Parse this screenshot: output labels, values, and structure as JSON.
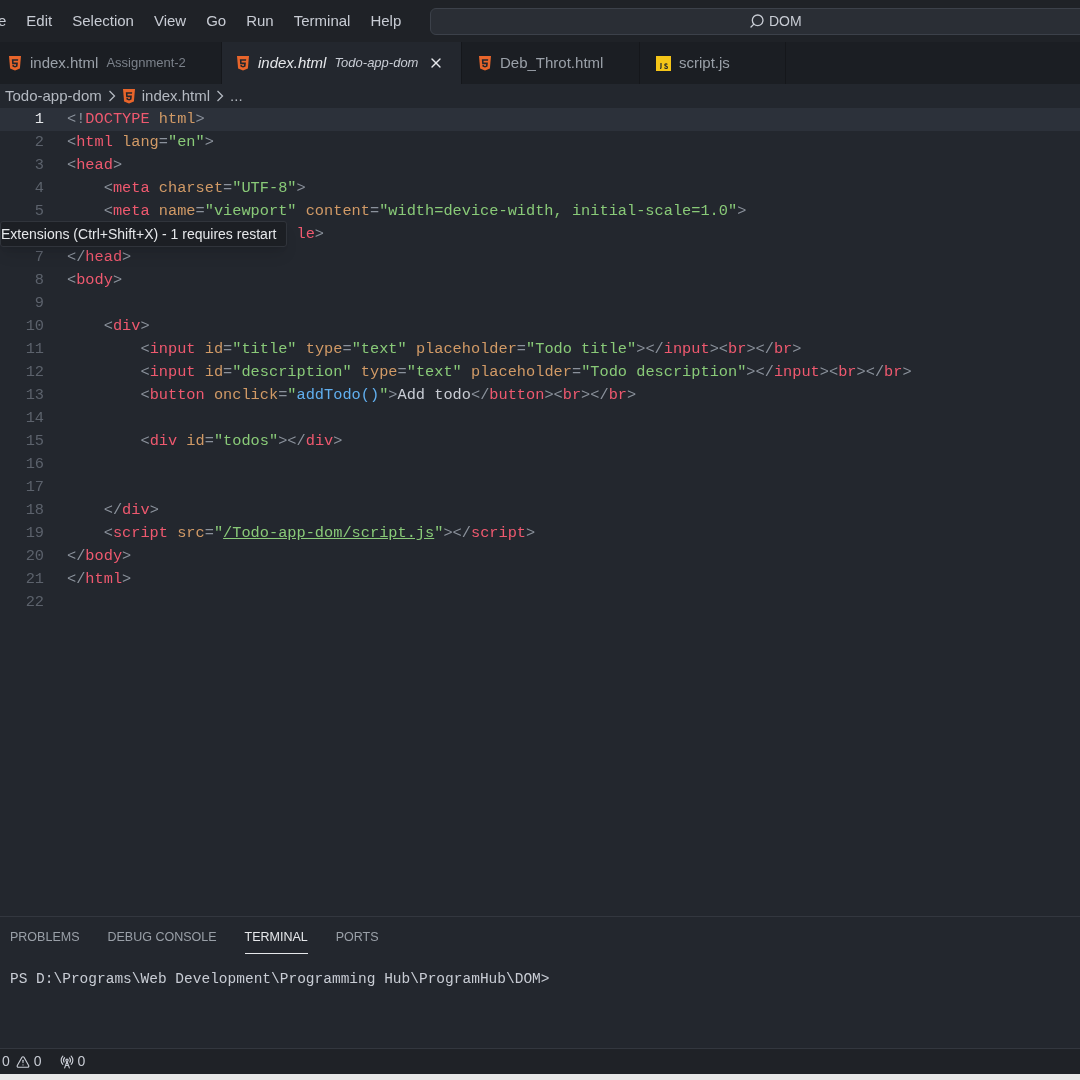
{
  "menu": [
    "e",
    "Edit",
    "Selection",
    "View",
    "Go",
    "Run",
    "Terminal",
    "Help"
  ],
  "search": {
    "value": "DOM"
  },
  "tabs": [
    {
      "label": "index.html",
      "description": "Assignment-2",
      "kind": "html",
      "selected": false,
      "preview": false
    },
    {
      "label": "index.html",
      "description": "Todo-app-dom",
      "kind": "html",
      "selected": true,
      "preview": true
    },
    {
      "label": "Deb_Throt.html",
      "kind": "html",
      "selected": false,
      "preview": false
    },
    {
      "label": "script.js",
      "kind": "js",
      "selected": false,
      "preview": false
    }
  ],
  "breadcrumb": [
    {
      "label": "Todo-app-dom",
      "kind": "folder"
    },
    {
      "label": "index.html",
      "kind": "html"
    },
    {
      "label": "...",
      "kind": "more"
    }
  ],
  "code_lines": [
    {
      "number": "1",
      "current": true,
      "tokens": [
        {
          "kind": "punct",
          "text": "<!"
        },
        {
          "kind": "tag",
          "text": "DOCTYPE"
        },
        {
          "kind": "attr",
          "text": " html"
        },
        {
          "kind": "punct",
          "text": ">"
        }
      ]
    },
    {
      "number": "2",
      "current": false,
      "tokens": [
        {
          "kind": "punct",
          "text": "<"
        },
        {
          "kind": "tag",
          "text": "html"
        },
        {
          "kind": "attr",
          "text": " lang"
        },
        {
          "kind": "punct",
          "text": "="
        },
        {
          "kind": "string",
          "text": "\"en\""
        },
        {
          "kind": "punct",
          "text": ">"
        }
      ]
    },
    {
      "number": "3",
      "current": false,
      "tokens": [
        {
          "kind": "punct",
          "text": "<"
        },
        {
          "kind": "tag",
          "text": "head"
        },
        {
          "kind": "punct",
          "text": ">"
        }
      ]
    },
    {
      "number": "4",
      "current": false,
      "tokens": [
        {
          "kind": "punct",
          "text": "    <"
        },
        {
          "kind": "tag",
          "text": "meta"
        },
        {
          "kind": "attr",
          "text": " charset"
        },
        {
          "kind": "punct",
          "text": "="
        },
        {
          "kind": "string",
          "text": "\"UTF-8\""
        },
        {
          "kind": "punct",
          "text": ">"
        }
      ]
    },
    {
      "number": "5",
      "current": false,
      "tokens": [
        {
          "kind": "punct",
          "text": "    <"
        },
        {
          "kind": "tag",
          "text": "meta"
        },
        {
          "kind": "attr",
          "text": " name"
        },
        {
          "kind": "punct",
          "text": "="
        },
        {
          "kind": "string",
          "text": "\"viewport\""
        },
        {
          "kind": "attr",
          "text": " content"
        },
        {
          "kind": "punct",
          "text": "="
        },
        {
          "kind": "string",
          "text": "\"width=device-width, initial-scale=1.0\""
        },
        {
          "kind": "punct",
          "text": ">"
        }
      ]
    },
    {
      "current": false,
      "tokens": [
        {
          "kind": "tag",
          "text": "                         le"
        },
        {
          "kind": "punct",
          "text": ">"
        }
      ]
    },
    {
      "number": "7",
      "current": false,
      "tokens": [
        {
          "kind": "punct",
          "text": "</"
        },
        {
          "kind": "tag",
          "text": "head"
        },
        {
          "kind": "punct",
          "text": ">"
        }
      ]
    },
    {
      "number": "8",
      "current": false,
      "tokens": [
        {
          "kind": "punct",
          "text": "<"
        },
        {
          "kind": "tag",
          "text": "body"
        },
        {
          "kind": "punct",
          "text": ">"
        }
      ]
    },
    {
      "number": "9",
      "current": false
    },
    {
      "number": "10",
      "current": false,
      "tokens": [
        {
          "kind": "punct",
          "text": "    <"
        },
        {
          "kind": "tag",
          "text": "div"
        },
        {
          "kind": "punct",
          "text": ">"
        }
      ]
    },
    {
      "number": "11",
      "current": false,
      "tokens": [
        {
          "kind": "punct",
          "text": "        <"
        },
        {
          "kind": "tag",
          "text": "input"
        },
        {
          "kind": "attr",
          "text": " id"
        },
        {
          "kind": "punct",
          "text": "="
        },
        {
          "kind": "string",
          "text": "\"title\""
        },
        {
          "kind": "attr",
          "text": " type"
        },
        {
          "kind": "punct",
          "text": "="
        },
        {
          "kind": "string",
          "text": "\"text\""
        },
        {
          "kind": "attr",
          "text": " placeholder"
        },
        {
          "kind": "punct",
          "text": "="
        },
        {
          "kind": "string",
          "text": "\"Todo title\""
        },
        {
          "kind": "punct",
          "text": "></"
        },
        {
          "kind": "tag",
          "text": "input"
        },
        {
          "kind": "punct",
          "text": "><"
        },
        {
          "kind": "tag",
          "text": "br"
        },
        {
          "kind": "punct",
          "text": "></"
        },
        {
          "kind": "tag",
          "text": "br"
        },
        {
          "kind": "punct",
          "text": ">"
        }
      ]
    },
    {
      "number": "12",
      "current": false,
      "tokens": [
        {
          "kind": "punct",
          "text": "        <"
        },
        {
          "kind": "tag",
          "text": "input"
        },
        {
          "kind": "attr",
          "text": " id"
        },
        {
          "kind": "punct",
          "text": "="
        },
        {
          "kind": "string",
          "text": "\"description\""
        },
        {
          "kind": "attr",
          "text": " type"
        },
        {
          "kind": "punct",
          "text": "="
        },
        {
          "kind": "string",
          "text": "\"text\""
        },
        {
          "kind": "attr",
          "text": " placeholder"
        },
        {
          "kind": "punct",
          "text": "="
        },
        {
          "kind": "string",
          "text": "\"Todo description\""
        },
        {
          "kind": "punct",
          "text": "></"
        },
        {
          "kind": "tag",
          "text": "input"
        },
        {
          "kind": "punct",
          "text": "><"
        },
        {
          "kind": "tag",
          "text": "br"
        },
        {
          "kind": "punct",
          "text": "></"
        },
        {
          "kind": "tag",
          "text": "br"
        },
        {
          "kind": "punct",
          "text": ">"
        }
      ]
    },
    {
      "number": "13",
      "current": false,
      "tokens": [
        {
          "kind": "punct",
          "text": "        <"
        },
        {
          "kind": "tag",
          "text": "button"
        },
        {
          "kind": "attr",
          "text": " onclick"
        },
        {
          "kind": "punct",
          "text": "="
        },
        {
          "kind": "string",
          "text": "\""
        },
        {
          "kind": "func",
          "text": "addTodo()"
        },
        {
          "kind": "string",
          "text": "\""
        },
        {
          "kind": "punct",
          "text": ">"
        },
        {
          "kind": "text",
          "text": "Add todo"
        },
        {
          "kind": "punct",
          "text": "</"
        },
        {
          "kind": "tag",
          "text": "button"
        },
        {
          "kind": "punct",
          "text": "><"
        },
        {
          "kind": "tag",
          "text": "br"
        },
        {
          "kind": "punct",
          "text": "></"
        },
        {
          "kind": "tag",
          "text": "br"
        },
        {
          "kind": "punct",
          "text": ">"
        }
      ]
    },
    {
      "number": "14",
      "current": false
    },
    {
      "number": "15",
      "current": false,
      "tokens": [
        {
          "kind": "punct",
          "text": "        <"
        },
        {
          "kind": "tag",
          "text": "div"
        },
        {
          "kind": "attr",
          "text": " id"
        },
        {
          "kind": "punct",
          "text": "="
        },
        {
          "kind": "string",
          "text": "\"todos\""
        },
        {
          "kind": "punct",
          "text": "></"
        },
        {
          "kind": "tag",
          "text": "div"
        },
        {
          "kind": "punct",
          "text": ">"
        }
      ]
    },
    {
      "number": "16",
      "current": false
    },
    {
      "number": "17",
      "current": false
    },
    {
      "number": "18",
      "current": false,
      "tokens": [
        {
          "kind": "punct",
          "text": "    </"
        },
        {
          "kind": "tag",
          "text": "div"
        },
        {
          "kind": "punct",
          "text": ">"
        }
      ]
    },
    {
      "number": "19",
      "current": false,
      "tokens": [
        {
          "kind": "punct",
          "text": "    <"
        },
        {
          "kind": "tag",
          "text": "script"
        },
        {
          "kind": "attr",
          "text": " src"
        },
        {
          "kind": "punct",
          "text": "="
        },
        {
          "kind": "string",
          "text": "\""
        },
        {
          "kind": "link",
          "text": "/Todo-app-dom/script.js"
        },
        {
          "kind": "string",
          "text": "\""
        },
        {
          "kind": "punct",
          "text": "></"
        },
        {
          "kind": "tag",
          "text": "script"
        },
        {
          "kind": "punct",
          "text": ">"
        }
      ]
    },
    {
      "number": "20",
      "current": false,
      "tokens": [
        {
          "kind": "punct",
          "text": "</"
        },
        {
          "kind": "tag",
          "text": "body"
        },
        {
          "kind": "punct",
          "text": ">"
        }
      ]
    },
    {
      "number": "21",
      "current": false,
      "tokens": [
        {
          "kind": "punct",
          "text": "</"
        },
        {
          "kind": "tag",
          "text": "html"
        },
        {
          "kind": "punct",
          "text": ">"
        }
      ]
    },
    {
      "number": "22",
      "current": false
    }
  ],
  "tooltip": "Extensions (Ctrl+Shift+X) - 1 requires restart",
  "panel": {
    "tabs": [
      {
        "label": "PROBLEMS",
        "selected": false
      },
      {
        "label": "DEBUG CONSOLE",
        "selected": false
      },
      {
        "label": "TERMINAL",
        "selected": true
      },
      {
        "label": "PORTS",
        "selected": false
      }
    ],
    "terminal_line": "PS D:\\Programs\\Web Development\\Programming Hub\\ProgramHub\\DOM>"
  },
  "status_bar": [
    {
      "kind": "plain",
      "count": "0"
    },
    {
      "kind": "warning",
      "count": "0"
    },
    {
      "kind": "broadcast",
      "count": "0"
    }
  ]
}
